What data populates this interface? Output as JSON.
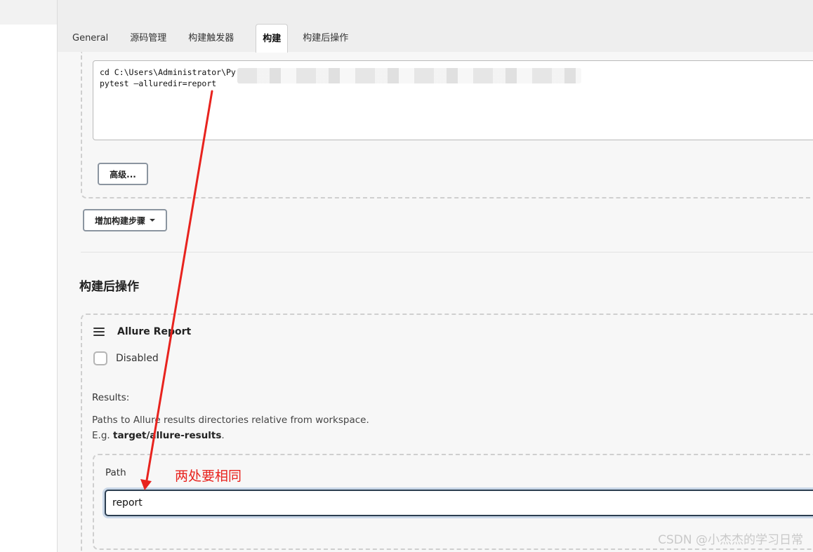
{
  "tabs": [
    {
      "label": "General",
      "active": false
    },
    {
      "label": "源码管理",
      "active": false
    },
    {
      "label": "构建触发器",
      "active": false
    },
    {
      "label": "构建",
      "active": true
    },
    {
      "label": "构建后操作",
      "active": false
    }
  ],
  "build": {
    "command_line1": "cd C:\\Users\\Administrator\\Py",
    "command_line2": "pytest —alluredir=report",
    "advanced_button": "高级...",
    "add_step_button": "增加构建步骤"
  },
  "post_build": {
    "section_title": "构建后操作",
    "plugin_title": "Allure Report",
    "disabled_label": "Disabled",
    "results_label": "Results:",
    "help_line1": "Paths to Allure results directories relative from workspace.",
    "help_line2_prefix": "E.g. ",
    "help_line2_bold": "target/allure-results",
    "help_line2_suffix": ".",
    "path_label": "Path",
    "path_value": "report"
  },
  "annotation": {
    "text": "两处要相同",
    "color": "#e8231e"
  },
  "watermark": "CSDN @小杰杰的学习日常"
}
